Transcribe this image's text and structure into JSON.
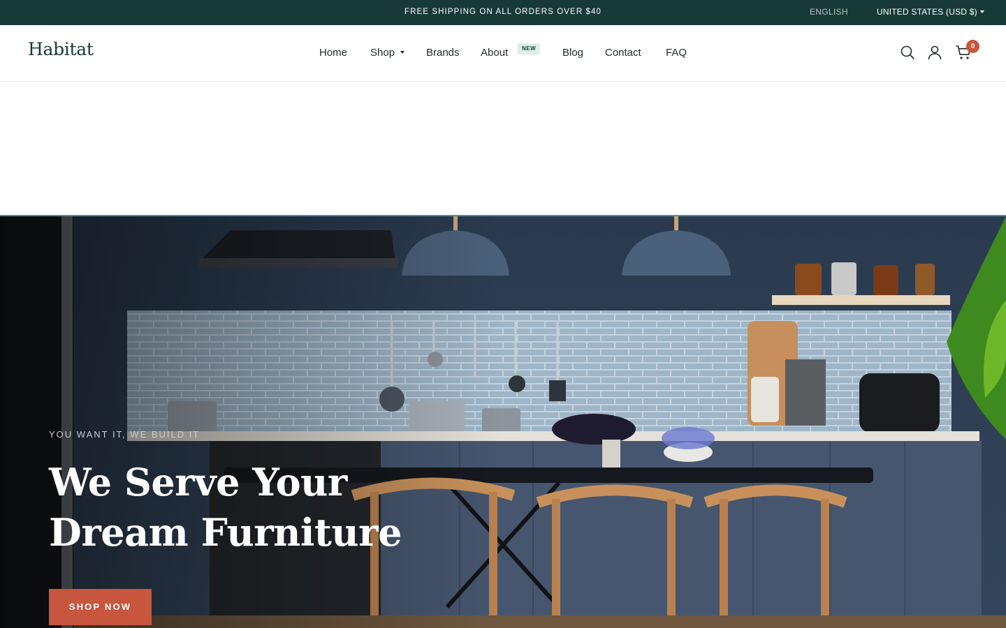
{
  "announcement": {
    "text": "FREE SHIPPING ON ALL ORDERS OVER $40",
    "language": "ENGLISH",
    "country": "UNITED STATES (USD $)"
  },
  "header": {
    "logo": "Habitat",
    "nav": [
      {
        "label": "Home"
      },
      {
        "label": "Shop",
        "has_dropdown": true
      },
      {
        "label": "Brands"
      },
      {
        "label": "About",
        "badge": "NEW"
      },
      {
        "label": "Blog"
      },
      {
        "label": "Contact"
      },
      {
        "label": "FAQ"
      }
    ],
    "icons": [
      "search-icon",
      "account-icon",
      "cart-icon"
    ],
    "cart_count": "0"
  },
  "hero": {
    "eyebrow": "YOU WANT IT, WE BUILD IT",
    "headline_line1": "We Serve Your",
    "headline_line2": "Dream Furniture",
    "cta_label": "SHOP NOW"
  },
  "colors": {
    "announcement_bg": "#173a36",
    "brand": "#173a36",
    "accent": "#c8553d",
    "badge_bg": "#dcefe9"
  }
}
